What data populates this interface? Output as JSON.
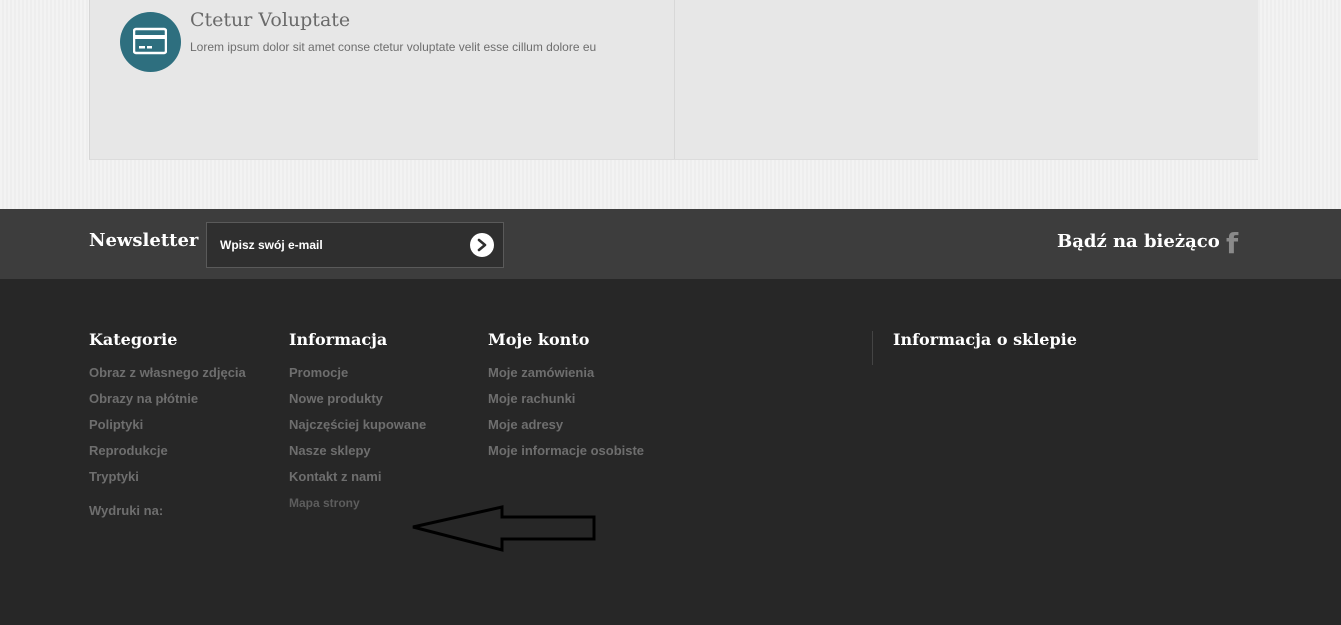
{
  "feature": {
    "icon": "credit-card-icon",
    "title": "Ctetur Voluptate",
    "text": "Lorem ipsum dolor sit amet conse ctetur voluptate velit esse cillum dolore eu"
  },
  "newsletter": {
    "label": "Newsletter",
    "placeholder": "Wpisz swój e-mail",
    "submit_icon": "chevron-right-icon"
  },
  "social": {
    "label": "Bądź na bieżąco",
    "icon": "facebook-icon"
  },
  "footer": {
    "categories": {
      "heading": "Kategorie",
      "links": [
        "Obraz z własnego zdjęcia",
        "Obrazy na płótnie",
        "Poliptyki",
        "Reprodukcje",
        "Tryptyki"
      ],
      "extra": "Wydruki na:"
    },
    "information": {
      "heading": "Informacja",
      "links": [
        "Promocje",
        "Nowe produkty",
        "Najczęściej kupowane",
        "Nasze sklepy",
        "Kontakt z nami",
        "Mapa strony"
      ]
    },
    "account": {
      "heading": "Moje konto",
      "links": [
        "Moje zamówienia",
        "Moje rachunki",
        "Moje adresy",
        "Moje informacje osobiste"
      ]
    },
    "store_info": {
      "heading": "Informacja o sklepie"
    }
  },
  "annotation": {
    "icon": "arrow-left-icon"
  }
}
